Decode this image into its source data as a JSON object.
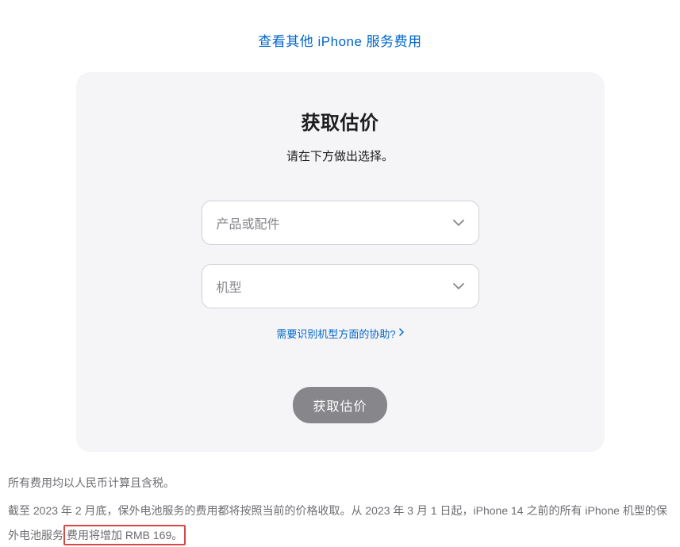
{
  "topLink": {
    "label": "查看其他 iPhone 服务费用"
  },
  "card": {
    "title": "获取估价",
    "subtitle": "请在下方做出选择。",
    "productSelect": {
      "placeholder": "产品或配件"
    },
    "modelSelect": {
      "placeholder": "机型"
    },
    "helpLink": {
      "label": "需要识别机型方面的协助?"
    },
    "submitButton": {
      "label": "获取估价"
    }
  },
  "footer": {
    "line1": "所有费用均以人民币计算且含税。",
    "line2_part1": "截至 2023 年 2 月底，保外电池服务的费用都将按照当前的价格收取。从 2023 年 3 月 1 日起，iPhone 14 之前的所有 iPhone 机型的保外电池服务",
    "line2_highlight": "费用将增加 RMB 169。"
  }
}
